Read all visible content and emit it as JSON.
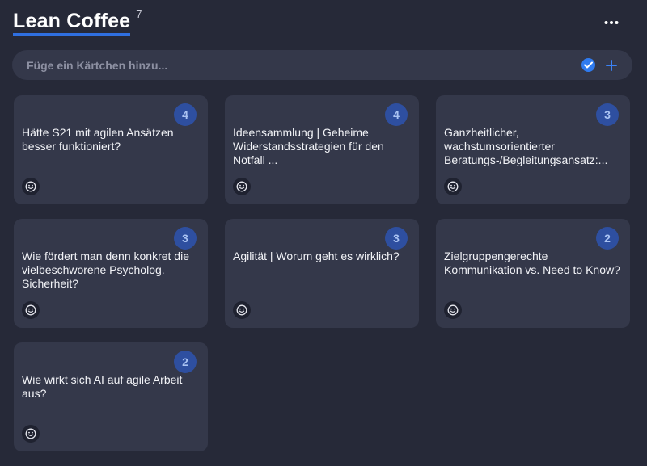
{
  "header": {
    "title": "Lean Coffee",
    "count": "7"
  },
  "input": {
    "placeholder": "Füge ein Kärtchen hinzu...",
    "value": ""
  },
  "colors": {
    "accent": "#2f6fe0",
    "badge_bg": "#2e4fa0",
    "card_bg": "#34384a",
    "page_bg": "#262938"
  },
  "cards": [
    {
      "votes": "4",
      "text": "Hätte S21 mit agilen Ansätzen besser funktioniert?"
    },
    {
      "votes": "4",
      "text": "Ideensammlung | Geheime Widerstandsstrategien für den Notfall ..."
    },
    {
      "votes": "3",
      "text": "Ganzheitlicher, wachstumsorientierter Beratungs-/Begleitungsansatz:..."
    },
    {
      "votes": "3",
      "text": "Wie fördert man denn konkret die vielbeschworene Psycholog. Sicherheit?"
    },
    {
      "votes": "3",
      "text": "Agilität | Worum geht es wirklich?"
    },
    {
      "votes": "2",
      "text": "Zielgruppengerechte Kommunikation vs. Need to Know?"
    },
    {
      "votes": "2",
      "text": "Wie wirkt sich AI auf agile Arbeit aus?"
    }
  ],
  "icons": {
    "more": "more-horizontal-icon",
    "check": "check-circle-icon",
    "plus": "plus-icon",
    "reaction": "smiley-icon"
  }
}
